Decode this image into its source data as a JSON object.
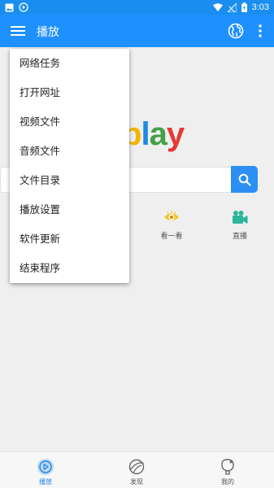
{
  "status_bar": {
    "time": "3:03"
  },
  "app_bar": {
    "title": "播放"
  },
  "logo": {
    "letters": [
      "p",
      "l",
      "a",
      "y"
    ]
  },
  "search": {
    "placeholder": ""
  },
  "quick_links": [
    {
      "label": "看一看",
      "icon": "eye-icon"
    },
    {
      "label": "直播",
      "icon": "video-camera-icon"
    }
  ],
  "menu": {
    "items": [
      {
        "label": "网络任务"
      },
      {
        "label": "打开网址"
      },
      {
        "label": "视频文件"
      },
      {
        "label": "音频文件"
      },
      {
        "label": "文件目录"
      },
      {
        "label": "播放设置"
      },
      {
        "label": "软件更新"
      },
      {
        "label": "结束程序"
      }
    ]
  },
  "tabs": [
    {
      "label": "播放",
      "icon": "play-icon",
      "active": true
    },
    {
      "label": "发现",
      "icon": "compass-icon",
      "active": false
    },
    {
      "label": "我的",
      "icon": "profile-icon",
      "active": false
    }
  ],
  "colors": {
    "primary": "#1e90ff",
    "logo": [
      "#f4b400",
      "#1e88e5",
      "#43a047",
      "#e53935"
    ]
  }
}
